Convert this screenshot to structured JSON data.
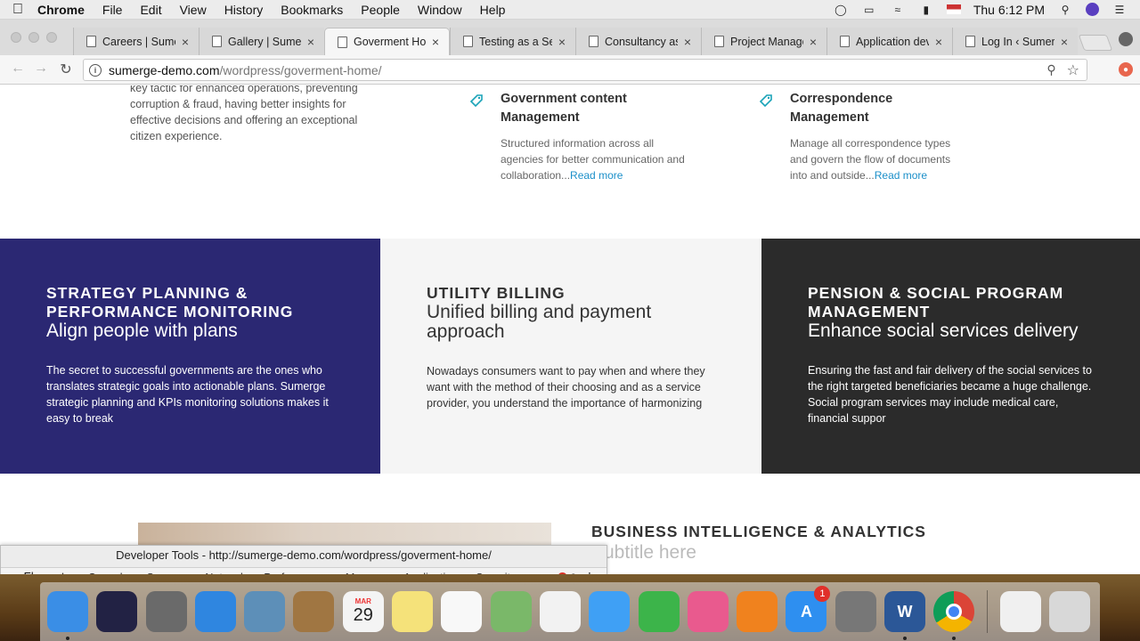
{
  "menubar": {
    "app": "Chrome",
    "items": [
      "File",
      "Edit",
      "View",
      "History",
      "Bookmarks",
      "People",
      "Window",
      "Help"
    ],
    "clock": "Thu 6:12 PM"
  },
  "tabs": [
    {
      "title": "Careers | Sume",
      "active": false
    },
    {
      "title": "Gallery | Sumer",
      "active": false
    },
    {
      "title": "Goverment Hor",
      "active": true
    },
    {
      "title": "Testing as a Ser",
      "active": false
    },
    {
      "title": "Consultancy as",
      "active": false
    },
    {
      "title": "Project Manage",
      "active": false
    },
    {
      "title": "Application dev",
      "active": false
    },
    {
      "title": "Log In ‹ Sumerg",
      "active": false
    }
  ],
  "address": {
    "host": "sumerge-demo.com",
    "path": "/wordpress/goverment-home/"
  },
  "page": {
    "intro_text": "key tactic for enhanced operations, preventing corruption & fraud, having better insights for effective decisions and offering an exceptional citizen experience.",
    "services": [
      {
        "title": "Government content Management",
        "desc": "Structured information across all agencies for better communication and collaboration...",
        "link": "Read more"
      },
      {
        "title": "Correspondence Management",
        "desc": "Manage all correspondence types and govern the flow of documents into and outside...",
        "link": "Read more"
      }
    ],
    "bands": [
      {
        "title": "STRATEGY PLANNING & PERFORMANCE MONITORING",
        "subtitle": "Align people with plans",
        "text": "The secret to successful governments are the ones who translates strategic goals into actionable plans. Sumerge strategic planning and KPIs monitoring solutions makes it easy to break",
        "color": "#2b2873"
      },
      {
        "title": "UTILITY BILLING",
        "subtitle": "Unified billing and payment approach",
        "text": "Nowadays consumers want to pay when and where they want with the method of their choosing and as a service provider, you understand the importance of harmonizing",
        "color": "#f5f5f5"
      },
      {
        "title": "PENSION & SOCIAL PROGRAM MANAGEMENT",
        "subtitle": "Enhance social services delivery",
        "text": "Ensuring the fast and fair delivery of the social services to the right targeted beneficiaries became a huge challenge. Social program services may include medical care, financial suppor",
        "color": "#2b2b2b"
      }
    ],
    "bi_title": "BUSINESS INTELLIGENCE & ANALYTICS",
    "bi_subtitle": "Subtitle here"
  },
  "devtools": {
    "title": "Developer Tools - http://sumerge-demo.com/wordpress/goverment-home/",
    "tabs": [
      "Elements",
      "Console",
      "Sources",
      "Network",
      "Performance",
      "Memory",
      "Application",
      "Security"
    ],
    "more": "»",
    "error_count": "2"
  },
  "dock": {
    "icons": [
      {
        "name": "finder-icon",
        "color": "#3a8ee6"
      },
      {
        "name": "siri-icon",
        "color": "#222244"
      },
      {
        "name": "launchpad-icon",
        "color": "#6a6a6a"
      },
      {
        "name": "safari-icon",
        "color": "#2f86e0"
      },
      {
        "name": "preview-icon",
        "color": "#5d8fb8"
      },
      {
        "name": "contacts-icon",
        "color": "#a07642"
      },
      {
        "name": "calendar-icon",
        "color": "#f4f4f4"
      },
      {
        "name": "notes-icon",
        "color": "#f5e27a"
      },
      {
        "name": "reminders-icon",
        "color": "#f8f8f8"
      },
      {
        "name": "maps-icon",
        "color": "#7ab869"
      },
      {
        "name": "photos-icon",
        "color": "#f2f2f2"
      },
      {
        "name": "messages-icon",
        "color": "#3fa0f5"
      },
      {
        "name": "facetime-icon",
        "color": "#3cb44a"
      },
      {
        "name": "itunes-icon",
        "color": "#e95a8e"
      },
      {
        "name": "ibooks-icon",
        "color": "#f0821e"
      },
      {
        "name": "app-store-icon",
        "color": "#2e8ff0"
      },
      {
        "name": "system-preferences-icon",
        "color": "#777777"
      },
      {
        "name": "word-icon",
        "color": "#2b5797"
      },
      {
        "name": "chrome-icon",
        "color": "#e8e8e8"
      }
    ],
    "calendar_month": "MAR",
    "calendar_day": "29",
    "appstore_badge": "1"
  }
}
